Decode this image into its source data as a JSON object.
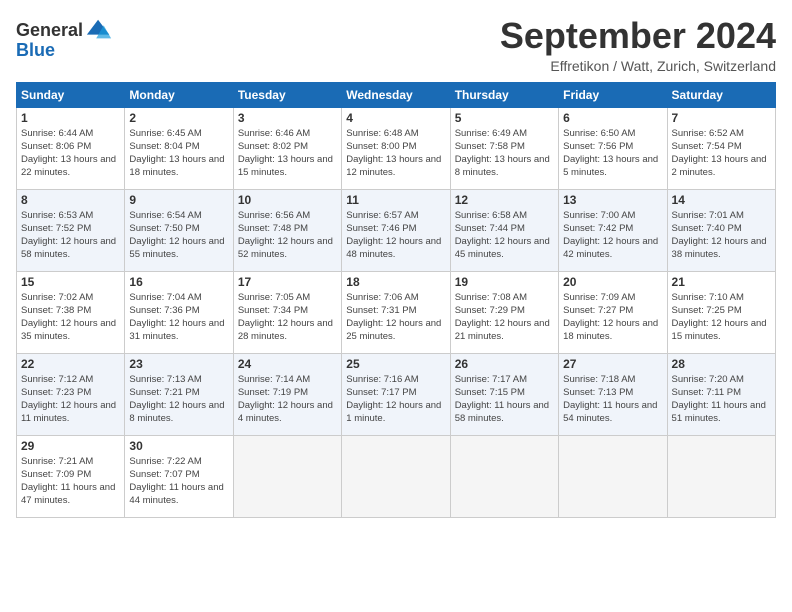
{
  "header": {
    "logo_general": "General",
    "logo_blue": "Blue",
    "month_title": "September 2024",
    "location": "Effretikon / Watt, Zurich, Switzerland"
  },
  "days_of_week": [
    "Sunday",
    "Monday",
    "Tuesday",
    "Wednesday",
    "Thursday",
    "Friday",
    "Saturday"
  ],
  "weeks": [
    [
      {
        "day": "1",
        "sunrise": "6:44 AM",
        "sunset": "8:06 PM",
        "daylight": "13 hours and 22 minutes."
      },
      {
        "day": "2",
        "sunrise": "6:45 AM",
        "sunset": "8:04 PM",
        "daylight": "13 hours and 18 minutes."
      },
      {
        "day": "3",
        "sunrise": "6:46 AM",
        "sunset": "8:02 PM",
        "daylight": "13 hours and 15 minutes."
      },
      {
        "day": "4",
        "sunrise": "6:48 AM",
        "sunset": "8:00 PM",
        "daylight": "13 hours and 12 minutes."
      },
      {
        "day": "5",
        "sunrise": "6:49 AM",
        "sunset": "7:58 PM",
        "daylight": "13 hours and 8 minutes."
      },
      {
        "day": "6",
        "sunrise": "6:50 AM",
        "sunset": "7:56 PM",
        "daylight": "13 hours and 5 minutes."
      },
      {
        "day": "7",
        "sunrise": "6:52 AM",
        "sunset": "7:54 PM",
        "daylight": "13 hours and 2 minutes."
      }
    ],
    [
      {
        "day": "8",
        "sunrise": "6:53 AM",
        "sunset": "7:52 PM",
        "daylight": "12 hours and 58 minutes."
      },
      {
        "day": "9",
        "sunrise": "6:54 AM",
        "sunset": "7:50 PM",
        "daylight": "12 hours and 55 minutes."
      },
      {
        "day": "10",
        "sunrise": "6:56 AM",
        "sunset": "7:48 PM",
        "daylight": "12 hours and 52 minutes."
      },
      {
        "day": "11",
        "sunrise": "6:57 AM",
        "sunset": "7:46 PM",
        "daylight": "12 hours and 48 minutes."
      },
      {
        "day": "12",
        "sunrise": "6:58 AM",
        "sunset": "7:44 PM",
        "daylight": "12 hours and 45 minutes."
      },
      {
        "day": "13",
        "sunrise": "7:00 AM",
        "sunset": "7:42 PM",
        "daylight": "12 hours and 42 minutes."
      },
      {
        "day": "14",
        "sunrise": "7:01 AM",
        "sunset": "7:40 PM",
        "daylight": "12 hours and 38 minutes."
      }
    ],
    [
      {
        "day": "15",
        "sunrise": "7:02 AM",
        "sunset": "7:38 PM",
        "daylight": "12 hours and 35 minutes."
      },
      {
        "day": "16",
        "sunrise": "7:04 AM",
        "sunset": "7:36 PM",
        "daylight": "12 hours and 31 minutes."
      },
      {
        "day": "17",
        "sunrise": "7:05 AM",
        "sunset": "7:34 PM",
        "daylight": "12 hours and 28 minutes."
      },
      {
        "day": "18",
        "sunrise": "7:06 AM",
        "sunset": "7:31 PM",
        "daylight": "12 hours and 25 minutes."
      },
      {
        "day": "19",
        "sunrise": "7:08 AM",
        "sunset": "7:29 PM",
        "daylight": "12 hours and 21 minutes."
      },
      {
        "day": "20",
        "sunrise": "7:09 AM",
        "sunset": "7:27 PM",
        "daylight": "12 hours and 18 minutes."
      },
      {
        "day": "21",
        "sunrise": "7:10 AM",
        "sunset": "7:25 PM",
        "daylight": "12 hours and 15 minutes."
      }
    ],
    [
      {
        "day": "22",
        "sunrise": "7:12 AM",
        "sunset": "7:23 PM",
        "daylight": "12 hours and 11 minutes."
      },
      {
        "day": "23",
        "sunrise": "7:13 AM",
        "sunset": "7:21 PM",
        "daylight": "12 hours and 8 minutes."
      },
      {
        "day": "24",
        "sunrise": "7:14 AM",
        "sunset": "7:19 PM",
        "daylight": "12 hours and 4 minutes."
      },
      {
        "day": "25",
        "sunrise": "7:16 AM",
        "sunset": "7:17 PM",
        "daylight": "12 hours and 1 minute."
      },
      {
        "day": "26",
        "sunrise": "7:17 AM",
        "sunset": "7:15 PM",
        "daylight": "11 hours and 58 minutes."
      },
      {
        "day": "27",
        "sunrise": "7:18 AM",
        "sunset": "7:13 PM",
        "daylight": "11 hours and 54 minutes."
      },
      {
        "day": "28",
        "sunrise": "7:20 AM",
        "sunset": "7:11 PM",
        "daylight": "11 hours and 51 minutes."
      }
    ],
    [
      {
        "day": "29",
        "sunrise": "7:21 AM",
        "sunset": "7:09 PM",
        "daylight": "11 hours and 47 minutes."
      },
      {
        "day": "30",
        "sunrise": "7:22 AM",
        "sunset": "7:07 PM",
        "daylight": "11 hours and 44 minutes."
      },
      null,
      null,
      null,
      null,
      null
    ]
  ],
  "labels": {
    "sunrise": "Sunrise:",
    "sunset": "Sunset:",
    "daylight": "Daylight:"
  }
}
